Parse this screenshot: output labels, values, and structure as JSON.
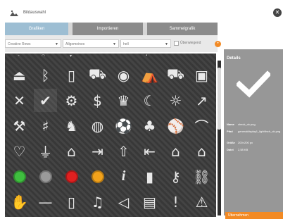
{
  "window": {
    "title": "Bildauswahl"
  },
  "tabs": [
    {
      "label": "Grafiken",
      "active": true
    },
    {
      "label": "Importieren",
      "active": false
    },
    {
      "label": "Sammelgrafik",
      "active": false
    }
  ],
  "filters": {
    "source": "Creative Rows",
    "category": "Allgemeines",
    "style": "hell",
    "checkbox_label": "Überwiegend"
  },
  "grid": {
    "icons": [
      [
        "lamp",
        "bluetooth",
        "battery",
        "tractor",
        "webcam",
        "bed-person",
        "car",
        "framed-car"
      ],
      [
        "x",
        "checkmark",
        "server-gear",
        "cash-sign",
        "crown",
        "moon",
        "sun",
        "chart-line"
      ],
      [
        "dumbbell",
        "equalizer",
        "chess",
        "rss-circle",
        "soccer-ball",
        "tree",
        "baseball",
        "hanger"
      ],
      [
        "heart",
        "plug",
        "house-outline",
        "door-exit",
        "home-arrow",
        "door-enter",
        "house-check",
        "house-solid"
      ],
      [
        "green-dot",
        "grey-dot",
        "red-dot",
        "orange-dot",
        "info",
        "phone",
        "key",
        "link-broken"
      ],
      [
        "hands-raised",
        "minus",
        "phone-outline",
        "music",
        "volume-mute",
        "save",
        "exclamation",
        "warning"
      ]
    ],
    "selected_icon": "checkmark",
    "colors": {
      "green-dot": "#3fbf3f",
      "grey-dot": "#9a9a9a",
      "red-dot": "#e02020",
      "orange-dot": "#f2a21b"
    }
  },
  "details": {
    "header": "Details",
    "name_label": "Name",
    "name_value": "check_ok.png",
    "path_label": "Pfad",
    "path_value": "generaldisplay1_lightfinch_ok.png",
    "size_label": "Größe",
    "size_value": "200×200 px",
    "file_label": "Datei",
    "file_value": "2,58 KB"
  },
  "apply_button": "Übernehmen",
  "accent": "#f28a24"
}
